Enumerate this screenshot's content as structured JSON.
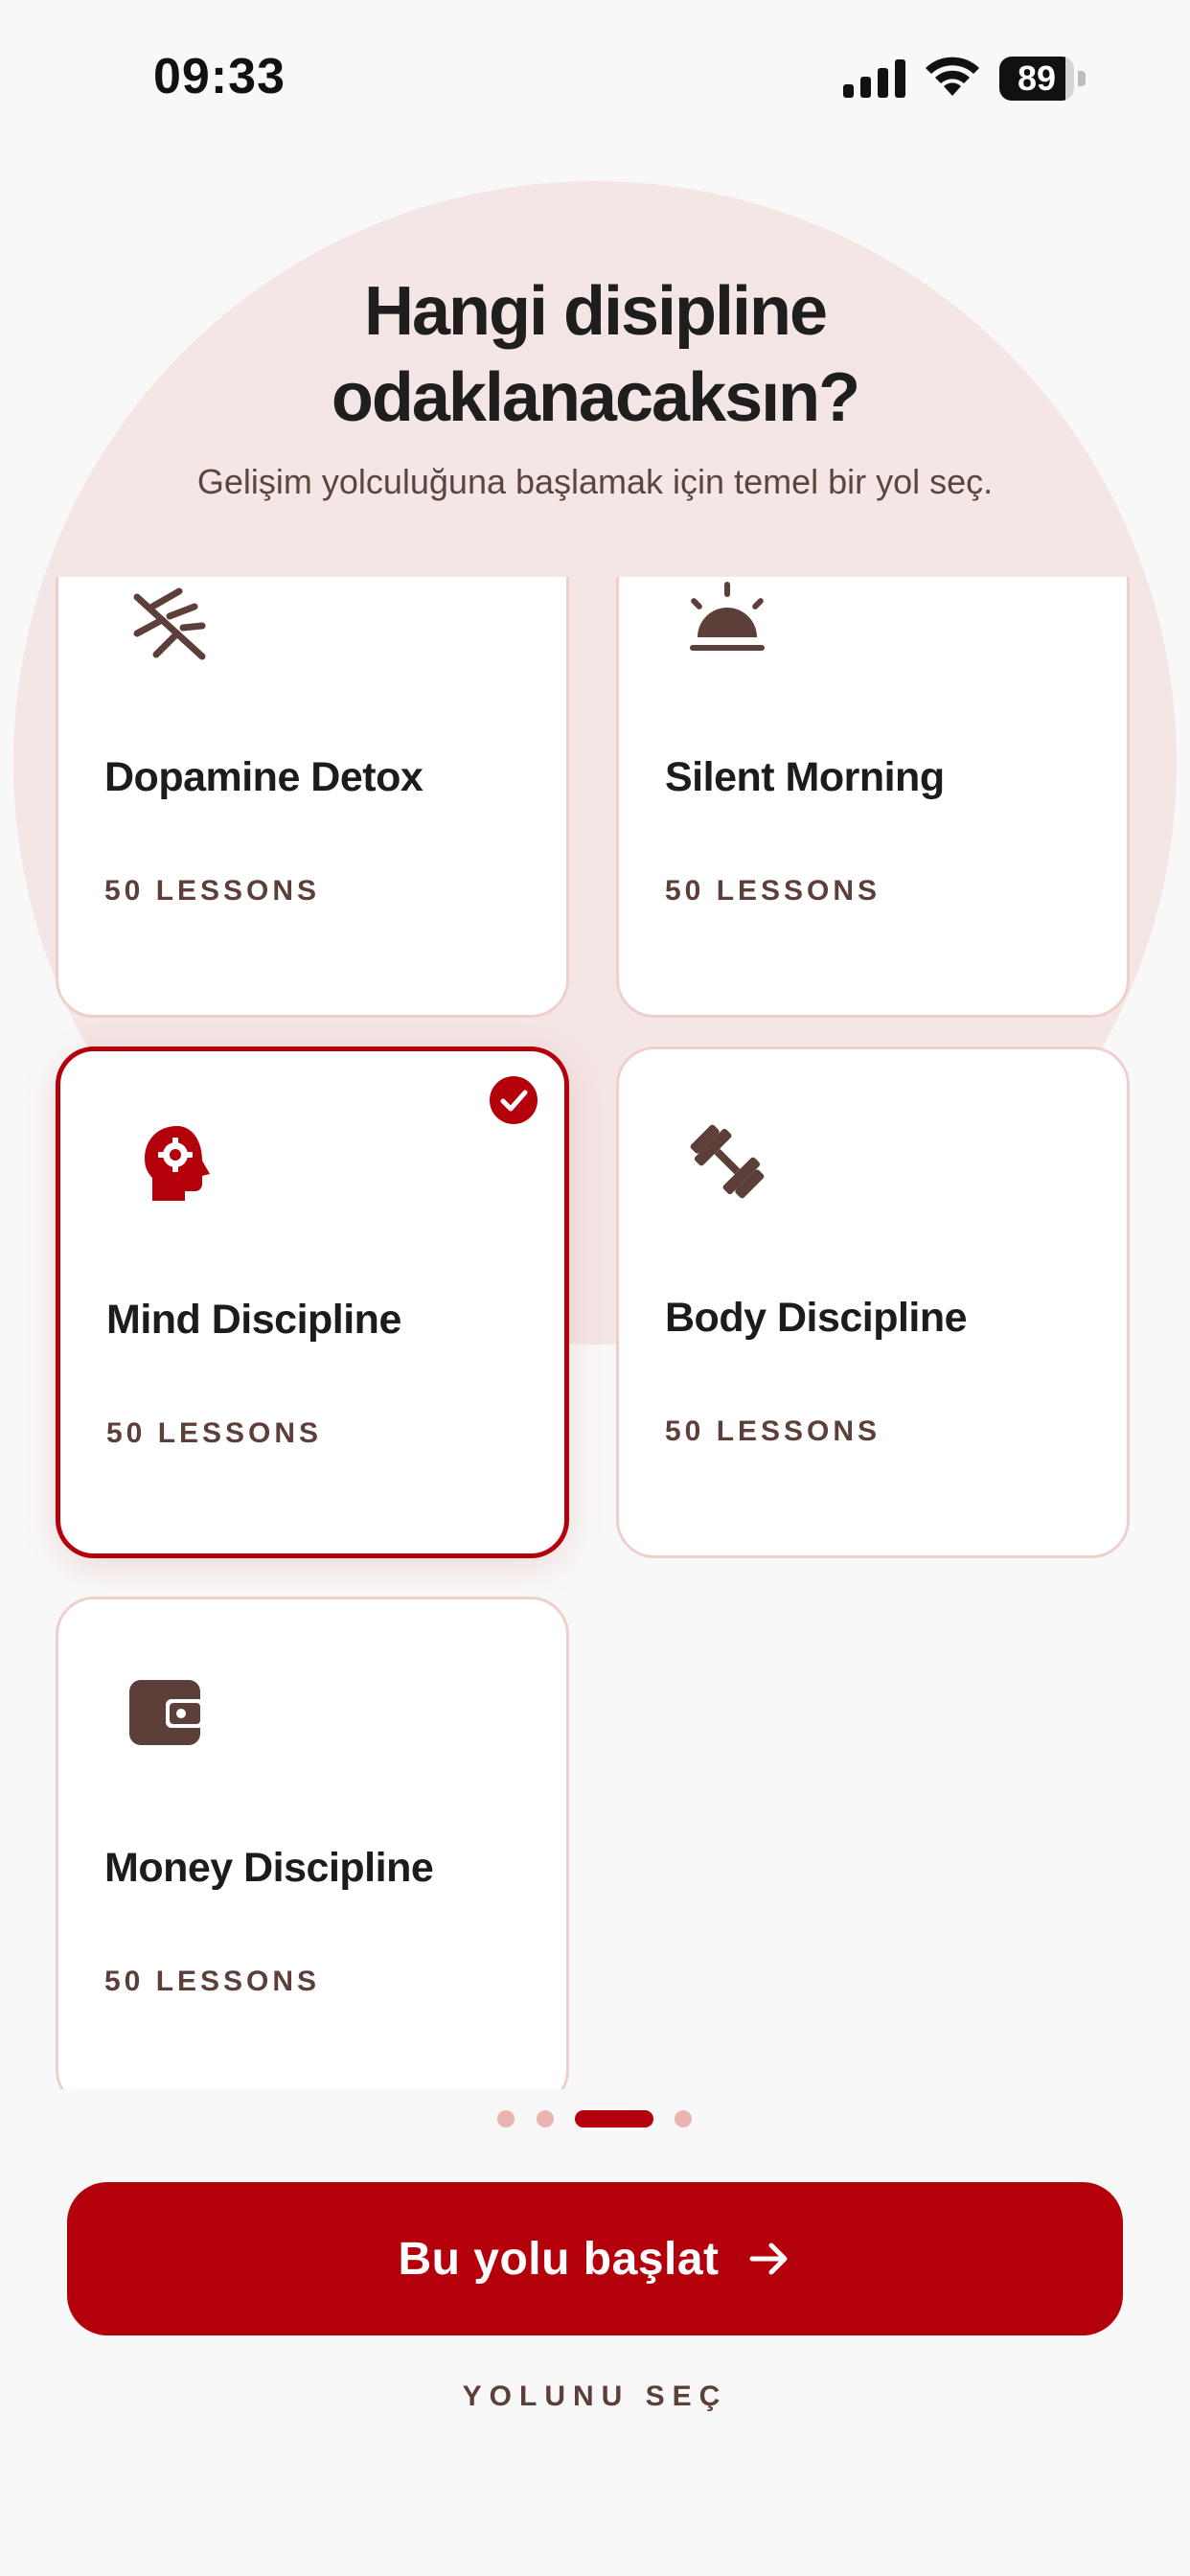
{
  "status_bar": {
    "time": "09:33",
    "battery_percent": "89",
    "battery_level": 0.89
  },
  "header": {
    "title": "Hangi disipline odaklanacaksın?",
    "subtitle": "Gelişim yolculuğuna başlamak için temel bir yol seç."
  },
  "cards": [
    {
      "name": "Dopamine Detox",
      "lessons": "50 LESSONS",
      "icon": "dopamine-detox-icon",
      "selected": false
    },
    {
      "name": "Silent Morning",
      "lessons": "50 LESSONS",
      "icon": "sunrise-icon",
      "selected": false
    },
    {
      "name": "Mind Discipline",
      "lessons": "50 LESSONS",
      "icon": "head-gear-icon",
      "selected": true
    },
    {
      "name": "Body Discipline",
      "lessons": "50 LESSONS",
      "icon": "dumbbell-icon",
      "selected": false
    },
    {
      "name": "Money Discipline",
      "lessons": "50 LESSONS",
      "icon": "wallet-icon",
      "selected": false
    }
  ],
  "pagination": {
    "total": 4,
    "active_index": 2
  },
  "cta": {
    "label": "Bu yolu başlat",
    "icon": "arrow-right-icon"
  },
  "footer": {
    "label": "YOLUNU SEÇ"
  },
  "colors": {
    "accent": "#b4000a",
    "icon_brown": "#5d3f3a",
    "background": "#f8f8f8",
    "circle": "#f4e6e5",
    "card_border": "#f0cfcb"
  }
}
